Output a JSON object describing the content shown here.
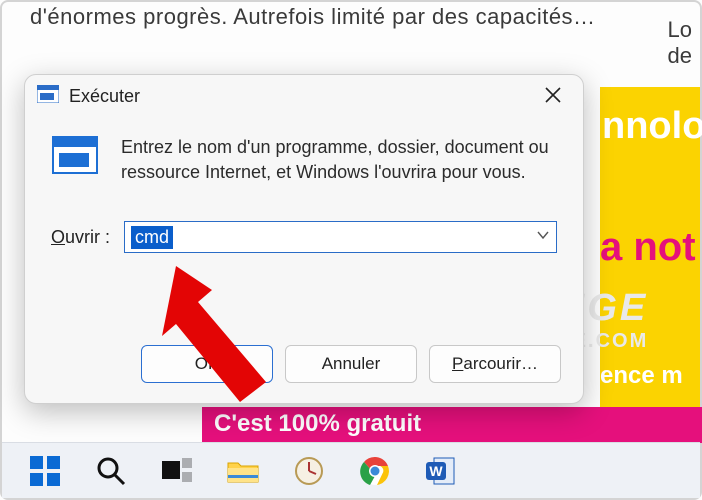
{
  "background": {
    "article_fragment": "d'énormes progrès. Autrefois limité par des capacités…",
    "right_fragment_1": "Lo",
    "right_fragment_2": "de",
    "banner_word_1": "nnolo",
    "banner_word_2": "a not",
    "banner_word_3": "ence m",
    "pink_band": "C'est 100% gratuit",
    "watermark_line1": "PRODIGE",
    "watermark_line2": "MOBILE.COM"
  },
  "dialog": {
    "title": "Exécuter",
    "description": "Entrez le nom d'un programme, dossier, document ou ressource Internet, et Windows l'ouvrira pour vous.",
    "open_label_prefix": "O",
    "open_label_rest": "uvrir :",
    "input_value": "cmd",
    "buttons": {
      "ok": "OK",
      "cancel": "Annuler",
      "browse_prefix": "P",
      "browse_rest": "arcourir…"
    }
  },
  "taskbar": {
    "items": [
      "start",
      "search",
      "task-view",
      "file-explorer",
      "clock",
      "chrome",
      "word"
    ]
  }
}
